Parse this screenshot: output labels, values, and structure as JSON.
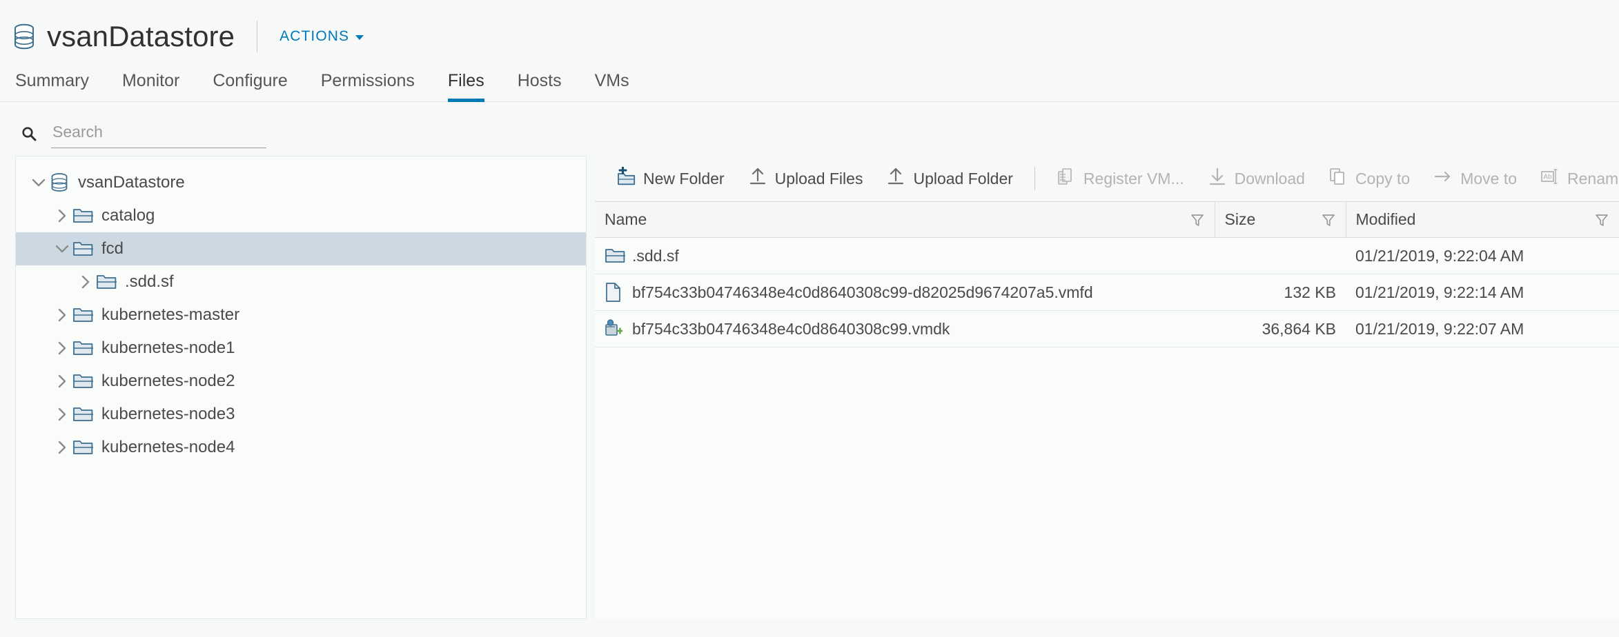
{
  "header": {
    "title": "vsanDatastore",
    "icon": "datastore-icon",
    "actions_label": "ACTIONS"
  },
  "tabs": [
    {
      "label": "Summary",
      "active": false
    },
    {
      "label": "Monitor",
      "active": false
    },
    {
      "label": "Configure",
      "active": false
    },
    {
      "label": "Permissions",
      "active": false
    },
    {
      "label": "Files",
      "active": true
    },
    {
      "label": "Hosts",
      "active": false
    },
    {
      "label": "VMs",
      "active": false
    }
  ],
  "search": {
    "placeholder": "Search",
    "value": "",
    "icon": "search-icon"
  },
  "tree": [
    {
      "label": "vsanDatastore",
      "level": 0,
      "icon": "datastore-icon",
      "expanded": true,
      "selected": false
    },
    {
      "label": "catalog",
      "level": 1,
      "icon": "folder-icon",
      "expanded": false,
      "selected": false
    },
    {
      "label": "fcd",
      "level": 1,
      "icon": "folder-icon",
      "expanded": true,
      "selected": true
    },
    {
      "label": ".sdd.sf",
      "level": 2,
      "icon": "folder-icon",
      "expanded": false,
      "selected": false
    },
    {
      "label": "kubernetes-master",
      "level": 1,
      "icon": "folder-icon",
      "expanded": false,
      "selected": false
    },
    {
      "label": "kubernetes-node1",
      "level": 1,
      "icon": "folder-icon",
      "expanded": false,
      "selected": false
    },
    {
      "label": "kubernetes-node2",
      "level": 1,
      "icon": "folder-icon",
      "expanded": false,
      "selected": false
    },
    {
      "label": "kubernetes-node3",
      "level": 1,
      "icon": "folder-icon",
      "expanded": false,
      "selected": false
    },
    {
      "label": "kubernetes-node4",
      "level": 1,
      "icon": "folder-icon",
      "expanded": false,
      "selected": false
    }
  ],
  "toolbar": [
    {
      "label": "New Folder",
      "icon": "new-folder-icon",
      "disabled": false
    },
    {
      "label": "Upload Files",
      "icon": "upload-icon",
      "disabled": false
    },
    {
      "label": "Upload Folder",
      "icon": "upload-icon",
      "disabled": false
    },
    {
      "label": "Register VM...",
      "icon": "register-vm-icon",
      "disabled": true
    },
    {
      "label": "Download",
      "icon": "download-icon",
      "disabled": true
    },
    {
      "label": "Copy to",
      "icon": "copy-icon",
      "disabled": true
    },
    {
      "label": "Move to",
      "icon": "move-arrow-icon",
      "disabled": true
    },
    {
      "label": "Rename to",
      "icon": "rename-icon",
      "disabled": true
    }
  ],
  "table": {
    "columns": [
      {
        "label": "Name",
        "filterable": true
      },
      {
        "label": "Size",
        "filterable": true
      },
      {
        "label": "Modified",
        "filterable": true
      }
    ],
    "rows": [
      {
        "icon": "folder-icon",
        "name": ".sdd.sf",
        "size": "",
        "modified": "01/21/2019, 9:22:04 AM"
      },
      {
        "icon": "file-icon",
        "name": "bf754c33b04746348e4c0d8640308c99-d82025d9674207a5.vmfd",
        "size": "132 KB",
        "modified": "01/21/2019, 9:22:14 AM"
      },
      {
        "icon": "vmdk-disk-icon",
        "name": "bf754c33b04746348e4c0d8640308c99.vmdk",
        "size": "36,864 KB",
        "modified": "01/21/2019, 9:22:07 AM"
      }
    ]
  },
  "colors": {
    "accent": "#0079b8",
    "selected_row": "#ccd9e3",
    "icon_blue": "#3c6e8f",
    "text": "#565656",
    "disabled": "#b3b3b3"
  }
}
